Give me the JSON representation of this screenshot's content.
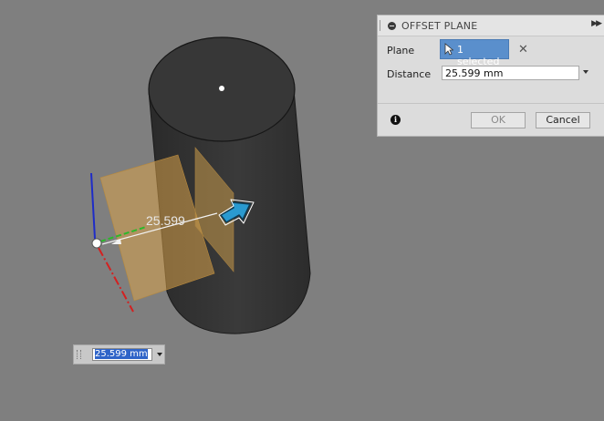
{
  "dialog": {
    "title": "OFFSET PLANE",
    "plane_label": "Plane",
    "plane_selection": "1 selected",
    "distance_label": "Distance",
    "distance_value": "25.599 mm",
    "ok_label": "OK",
    "cancel_label": "Cancel"
  },
  "viewport": {
    "dimension_label": "25.599",
    "float_input_value": "25.599 mm"
  },
  "colors": {
    "canvas": "#7f7f7f",
    "selection_blue": "#5a8fcc",
    "plane_orange": "#e0a850",
    "arrow_blue": "#2a9ad0"
  }
}
